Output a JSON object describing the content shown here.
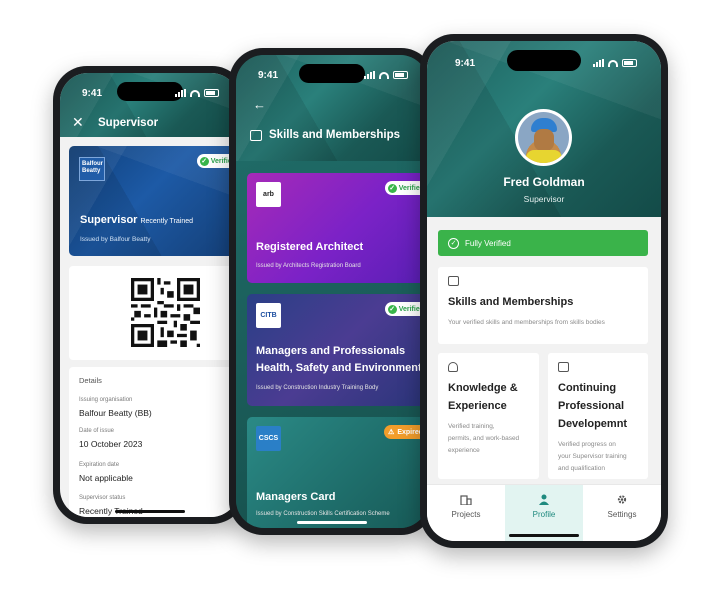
{
  "colors": {
    "teal": "#1b5e5b",
    "verified_green": "#3ab34a",
    "expired_orange": "#f29d2b",
    "accent": "#1f8a7f"
  },
  "phone1": {
    "time": "9:41",
    "header_title": "Supervisor",
    "card": {
      "logo": "Balfour Beatty",
      "badge": "Verified",
      "title": "Supervisor",
      "subtitle": "Recently Trained",
      "issued": "Issued by Balfour Beatty"
    },
    "details": {
      "heading": "Details",
      "rows": [
        {
          "label": "Issuing organisation",
          "value": "Balfour Beatty (BB)"
        },
        {
          "label": "Date of issue",
          "value": "10 October 2023"
        },
        {
          "label": "Expiration date",
          "value": "Not applicable"
        },
        {
          "label": "Supervisor status",
          "value": "Recently Trained"
        }
      ]
    }
  },
  "phone2": {
    "time": "9:41",
    "header_title": "Skills and Memberships",
    "cards": [
      {
        "logo": "arb",
        "badge": "Verified",
        "name": "Registered Architect",
        "name2": "",
        "issued": "Issued by Architects Registration Board"
      },
      {
        "logo": "CITB",
        "badge": "Verified",
        "name": "Managers and Professionals",
        "name2": "Health, Safety and Environment t",
        "issued": "Issued by Construction Industry Training Body"
      },
      {
        "logo": "CSCS",
        "badge": "Expired",
        "name": "Managers Card",
        "name2": "",
        "issued": "Issued by Construction Skills Certification Scheme"
      }
    ]
  },
  "phone3": {
    "time": "9:41",
    "name": "Fred Goldman",
    "role": "Supervisor",
    "verified_banner": "Fully Verified",
    "skills_card": {
      "title": "Skills and Memberships",
      "desc": "Your verified skills and memberships from skills bodies"
    },
    "knowledge_card": {
      "title_line1": "Knowledge &",
      "title_line2": "Experience",
      "desc_line1": "Verified training,",
      "desc_line2": "permits, and work-based",
      "desc_line3": "experience"
    },
    "cpd_card": {
      "title_line1": "Continuing",
      "title_line2": "Professional",
      "title_line3": "Developemnt",
      "desc_line1": "Verified progress on",
      "desc_line2": "your Supervisor training",
      "desc_line3": "and qualification"
    },
    "nav": [
      {
        "label": "Projects",
        "icon": "building-icon"
      },
      {
        "label": "Profile",
        "icon": "person-icon"
      },
      {
        "label": "Settings",
        "icon": "gear-icon"
      }
    ]
  }
}
